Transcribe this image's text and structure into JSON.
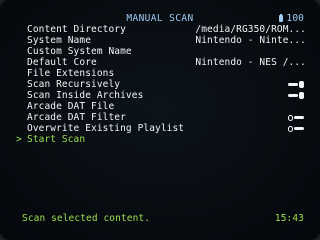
{
  "header": {
    "title": "MANUAL SCAN",
    "battery": "100",
    "battery_icon": "battery-icon"
  },
  "menu": {
    "items": [
      {
        "label": "Content Directory",
        "value": "/media/RG350/ROM..."
      },
      {
        "label": "System Name",
        "value": "Nintendo - Ninte..."
      },
      {
        "label": "Custom System Name",
        "value": ""
      },
      {
        "label": "Default Core",
        "value": "Nintendo - NES /..."
      },
      {
        "label": "File Extensions",
        "value": ""
      },
      {
        "label": "Scan Recursively",
        "toggle": "on"
      },
      {
        "label": "Scan Inside Archives",
        "toggle": "on"
      },
      {
        "label": "Arcade DAT File",
        "value": ""
      },
      {
        "label": "Arcade DAT Filter",
        "toggle": "off"
      },
      {
        "label": "Overwrite Existing Playlist",
        "toggle": "off"
      },
      {
        "label": "Start Scan",
        "selected": true
      }
    ],
    "cursor": ">"
  },
  "footer": {
    "hint": "Scan selected content.",
    "time": "15:43"
  },
  "colors": {
    "title": "#9ec9f0",
    "text": "#f2f4f8",
    "highlight": "#9be04e",
    "background": "#060b10"
  }
}
